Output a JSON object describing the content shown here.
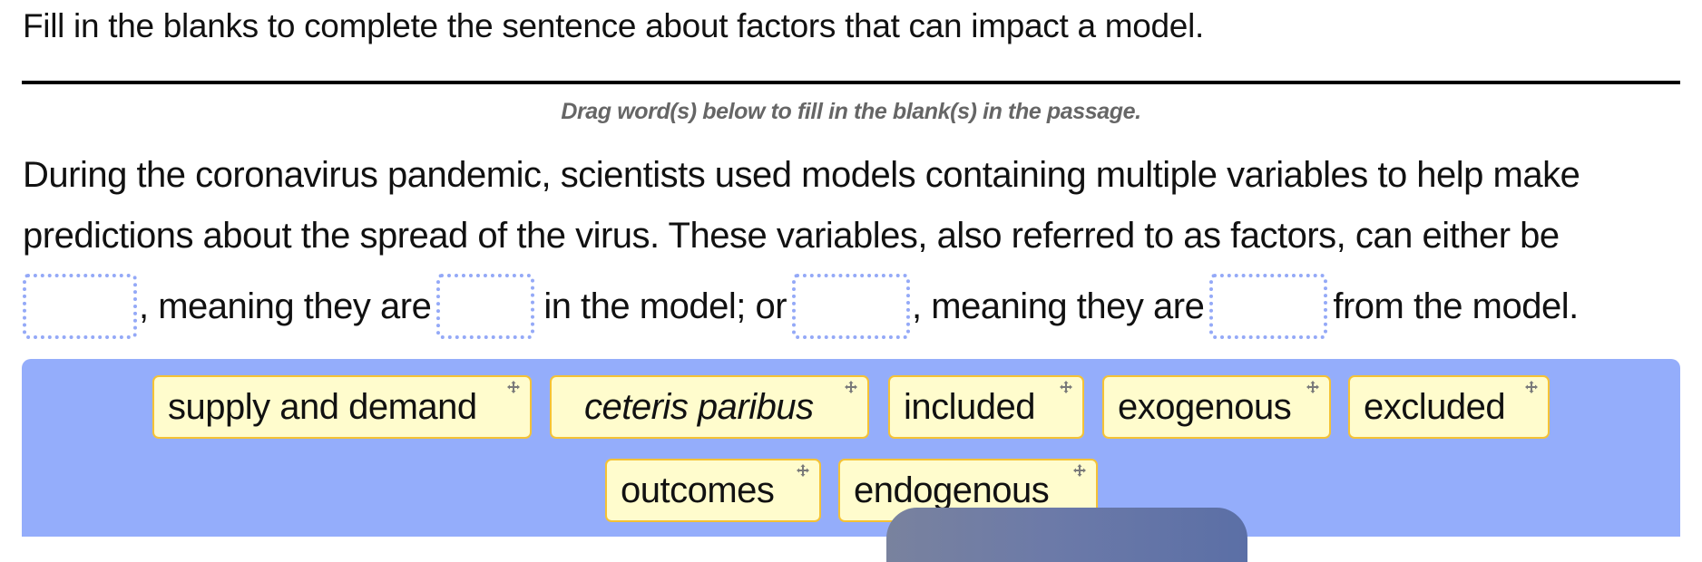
{
  "heading": "Fill in the blanks to complete the sentence about factors that can impact a model.",
  "instruction": "Drag word(s) below to fill in the blank(s) in the passage.",
  "passage": {
    "line1": "During the coronavirus pandemic, scientists used models containing multiple variables to help make",
    "line2": "predictions about the spread of the virus. These variables, also referred to as factors, can either be",
    "segments": [
      ", meaning they are",
      "in the model; or",
      ", meaning they are",
      "from the model."
    ],
    "blanks": [
      "",
      "",
      "",
      ""
    ]
  },
  "word_bank": {
    "tiles": [
      {
        "label": "supply and demand",
        "italic": false,
        "icon": "move-icon"
      },
      {
        "label": "ceteris paribus",
        "italic": true,
        "icon": "move-icon"
      },
      {
        "label": "included",
        "italic": false,
        "icon": "move-icon"
      },
      {
        "label": "exogenous",
        "italic": false,
        "icon": "move-icon"
      },
      {
        "label": "excluded",
        "italic": false,
        "icon": "move-icon"
      },
      {
        "label": "outcomes",
        "italic": false,
        "icon": "move-icon"
      },
      {
        "label": "endogenous",
        "italic": false,
        "icon": "move-icon"
      }
    ]
  },
  "colors": {
    "bank_background": "#94adfb",
    "tile_background": "#fffccd",
    "tile_border": "#f5c235",
    "blank_border": "#94a9f7",
    "instruction_text": "#666666"
  }
}
